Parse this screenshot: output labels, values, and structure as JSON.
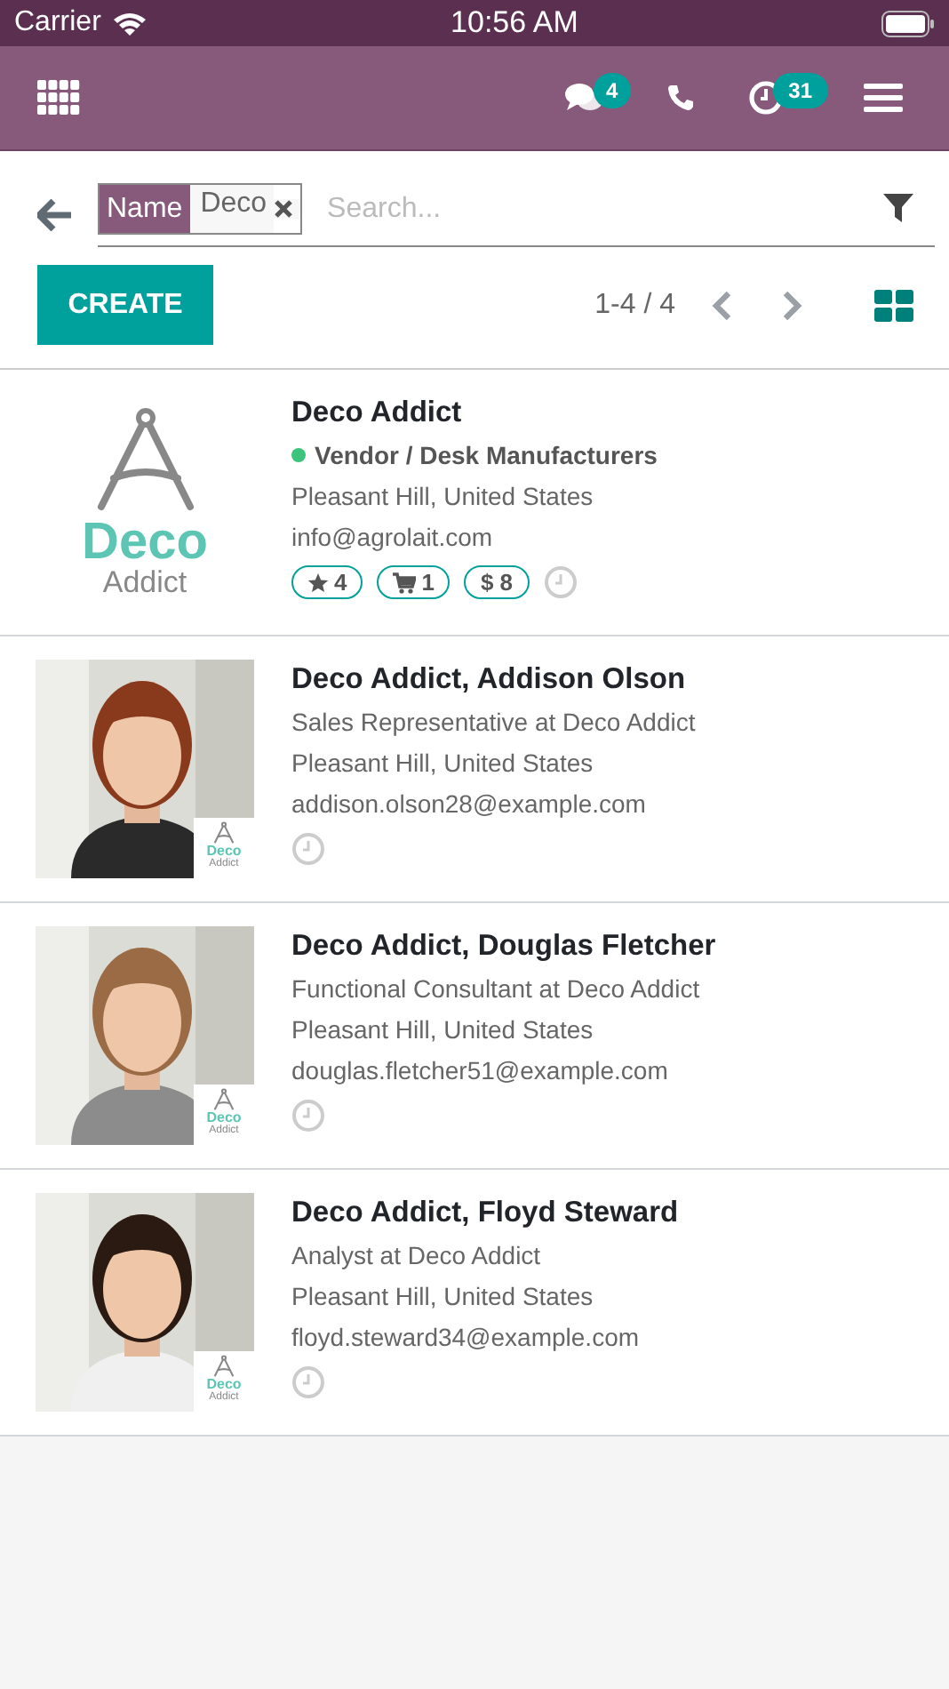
{
  "status_bar": {
    "carrier": "Carrier",
    "time": "10:56 AM"
  },
  "navbar": {
    "messages_count": "4",
    "activities_count": "31"
  },
  "search": {
    "facet": {
      "label": "Name",
      "value": "Deco"
    },
    "placeholder": "Search..."
  },
  "controls": {
    "create": "CREATE",
    "pager": "1-4 / 4"
  },
  "records": [
    {
      "kind": "company",
      "name": "Deco Addict",
      "logo_text": [
        "Deco",
        "Addict"
      ],
      "tag": {
        "label": "Vendor / Desk Manufacturers",
        "color": "#3cc47c"
      },
      "location": "Pleasant Hill, United States",
      "email": "info@agrolait.com",
      "stats": [
        {
          "kind": "star",
          "value": "4"
        },
        {
          "kind": "cart",
          "value": "1"
        },
        {
          "kind": "plain",
          "value": "$ 8"
        }
      ]
    },
    {
      "kind": "contact",
      "name": "Deco Addict, Addison Olson",
      "logo_text": [
        "Deco",
        "Addict"
      ],
      "job": "Sales Representative at Deco Addict",
      "location": "Pleasant Hill, United States",
      "email": "addison.olson28@example.com"
    },
    {
      "kind": "contact",
      "name": "Deco Addict, Douglas Fletcher",
      "logo_text": [
        "Deco",
        "Addict"
      ],
      "job": "Functional Consultant at Deco Addict",
      "location": "Pleasant Hill, United States",
      "email": "douglas.fletcher51@example.com"
    },
    {
      "kind": "contact",
      "name": "Deco Addict, Floyd Steward",
      "logo_text": [
        "Deco",
        "Addict"
      ],
      "job": "Analyst at Deco Addict",
      "location": "Pleasant Hill, United States",
      "email": "floyd.steward34@example.com"
    }
  ]
}
